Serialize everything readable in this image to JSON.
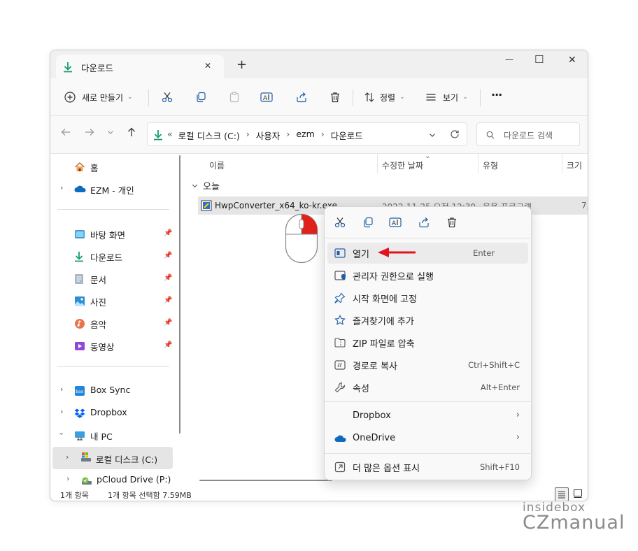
{
  "window": {
    "tab_title": "다운로드",
    "new_tab_symbol": "+",
    "close_tab_symbol": "✕",
    "min_symbol": "—",
    "max_symbol": "☐",
    "close_symbol": "✕"
  },
  "toolbar": {
    "new_label": "새로 만들기",
    "sort_label": "정렬",
    "view_label": "보기",
    "more_label": "···"
  },
  "address": {
    "prefix": "«",
    "crumbs": [
      "로컬 디스크 (C:)",
      "사용자",
      "ezm",
      "다운로드"
    ],
    "search_placeholder": "다운로드 검색"
  },
  "sidebar": {
    "top": [
      {
        "label": "홈",
        "icon": "home-icon"
      },
      {
        "label": "EZM - 개인",
        "icon": "onedrive-icon"
      }
    ],
    "pinned": [
      {
        "label": "바탕 화면",
        "icon": "desktop-icon"
      },
      {
        "label": "다운로드",
        "icon": "download-icon"
      },
      {
        "label": "문서",
        "icon": "document-icon"
      },
      {
        "label": "사진",
        "icon": "pictures-icon"
      },
      {
        "label": "음악",
        "icon": "music-icon"
      },
      {
        "label": "동영상",
        "icon": "video-icon"
      }
    ],
    "bottom": [
      {
        "label": "Box Sync",
        "icon": "box-icon"
      },
      {
        "label": "Dropbox",
        "icon": "dropbox-icon"
      },
      {
        "label": "내 PC",
        "icon": "pc-icon"
      },
      {
        "label": "로컬 디스크 (C:)",
        "icon": "drive-icon"
      },
      {
        "label": "pCloud Drive (P:)",
        "icon": "pcloud-icon"
      }
    ]
  },
  "columns": {
    "name": "이름",
    "modified": "수정한 날짜",
    "type": "유형",
    "size": "크기"
  },
  "group_label": "오늘",
  "file": {
    "name": "HwpConverter_x64_ko-kr.exe",
    "modified": "2022-11-25 오전 12:30",
    "type": "응용 프로그램",
    "size": "7,"
  },
  "status": {
    "count": "1개 항목",
    "selection": "1개 항목 선택함 7.59MB"
  },
  "context_menu": {
    "items": [
      {
        "label": "열기",
        "shortcut": "Enter"
      },
      {
        "label": "관리자 권한으로 실행",
        "shortcut": ""
      },
      {
        "label": "시작 화면에 고정",
        "shortcut": ""
      },
      {
        "label": "즐겨찾기에 추가",
        "shortcut": ""
      },
      {
        "label": "ZIP 파일로 압축",
        "shortcut": ""
      },
      {
        "label": "경로로 복사",
        "shortcut": "Ctrl+Shift+C"
      },
      {
        "label": "속성",
        "shortcut": "Alt+Enter"
      }
    ],
    "submenus": [
      {
        "label": "Dropbox",
        "arrow": "›"
      },
      {
        "label": "OneDrive",
        "arrow": "›"
      }
    ],
    "more": {
      "label": "더 많은 옵션 표시",
      "shortcut": "Shift+F10"
    }
  },
  "watermark": {
    "line1": "insidebox",
    "line2": "CZmanual"
  },
  "colors": {
    "accent": "#0067c0",
    "arrow": "#e0141e",
    "mouse_button": "#e0211c",
    "selection": "#e5e5e5",
    "hover": "#ebebeb"
  }
}
